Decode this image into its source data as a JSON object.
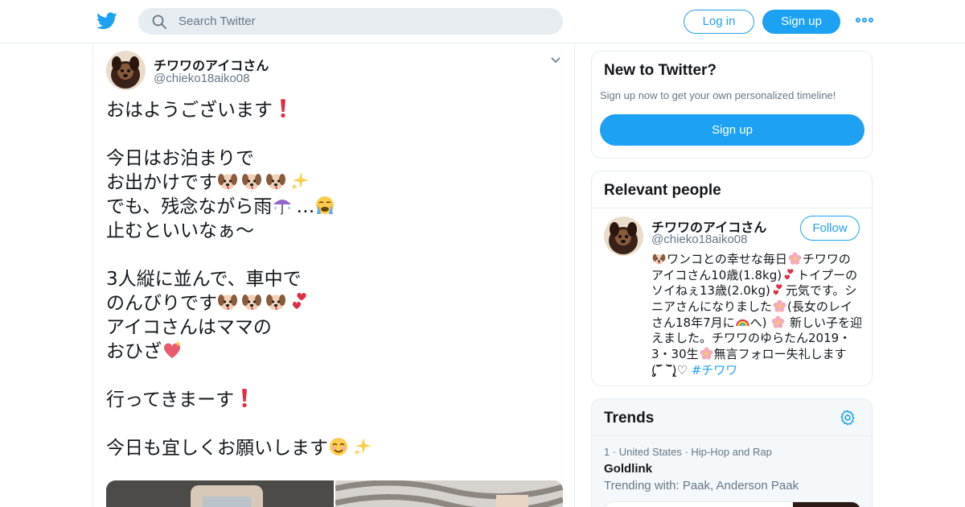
{
  "header": {
    "search_placeholder": "Search Twitter",
    "login_label": "Log in",
    "signup_label": "Sign up",
    "accent_color": "#1da1f2"
  },
  "tweet": {
    "display_name": "チワワのアイコさん",
    "handle": "@chieko18aiko08",
    "lines": [
      {
        "text": "おはようございます",
        "emojis": [
          "exclamation-icon"
        ]
      },
      {
        "text": "",
        "emojis": []
      },
      {
        "text": "今日はお泊まりで",
        "emojis": []
      },
      {
        "text": "お出かけです",
        "emojis": [
          "dog-face-icon",
          "dog-face-icon",
          "dog-face-icon",
          "sparkles-icon"
        ]
      },
      {
        "text": "でも、残念ながら雨",
        "emojis": [
          "umbrella-icon"
        ],
        "suffix": "…",
        "after": [
          "crying-face-icon"
        ]
      },
      {
        "text": "止むといいなぁ〜",
        "emojis": []
      },
      {
        "text": "",
        "emojis": []
      },
      {
        "text": "3人縦に並んで、車中で",
        "emojis": []
      },
      {
        "text": "のんびりです",
        "emojis": [
          "dog-face-icon",
          "dog-face-icon",
          "dog-face-icon",
          "two-hearts-icon"
        ]
      },
      {
        "text": "アイコさんはママの",
        "emojis": []
      },
      {
        "text": "おひざ",
        "emojis": [
          "sparkling-heart-icon"
        ]
      },
      {
        "text": "",
        "emojis": []
      },
      {
        "text": "行ってきまーす",
        "emojis": [
          "exclamation-icon"
        ]
      },
      {
        "text": "",
        "emojis": []
      },
      {
        "text": "今日も宜しくお願いします",
        "emojis": [
          "smiling-face-icon",
          "sparkles-icon"
        ]
      }
    ]
  },
  "new_to_twitter": {
    "title": "New to Twitter?",
    "subtitle": "Sign up now to get your own personalized timeline!",
    "button_label": "Sign up"
  },
  "relevant_people": {
    "title": "Relevant people",
    "display_name": "チワワのアイコさん",
    "handle": "@chieko18aiko08",
    "follow_label": "Follow",
    "bio_lines": [
      {
        "pre": [
          "dog-face-icon"
        ],
        "text": "ワンコとの幸せな毎日",
        "post": [
          "cherry-blossom-icon"
        ],
        "tail": "チワワの"
      },
      {
        "pre": [],
        "text": "アイコさん10歳(1.8kg)",
        "post": [
          "two-hearts-icon"
        ],
        "tail": "トイプーの"
      },
      {
        "pre": [],
        "text": "ソイねぇ13歳(2.0kg)",
        "post": [
          "two-hearts-icon"
        ],
        "tail": "元気です。シ"
      },
      {
        "pre": [],
        "text": "ニアさんになりました",
        "post": [
          "cherry-blossom-icon"
        ],
        "tail": "(長女のレイ"
      },
      {
        "pre": [],
        "text": "さん18年7月に",
        "post": [
          "rainbow-icon"
        ],
        "tail": "へ) "
      },
      {
        "pre": [],
        "text": "えました。チワワのゆらたん2019・",
        "post": [],
        "tail": ""
      },
      {
        "pre": [],
        "text": "3・30生",
        "post": [
          "cherry-blossom-icon"
        ],
        "tail": "無言フォロー失礼します"
      },
      {
        "pre": [],
        "text": "(̨̡‾᷄ ‾᷅)̧̢♡ ",
        "post": [],
        "tail": "",
        "hashtag": "#チワワ"
      }
    ],
    "bio_line5_extra": "新しい子を迎"
  },
  "trends": {
    "title": "Trends",
    "items": [
      {
        "rank": "1",
        "location": "United States",
        "category": "Hip-Hop and Rap",
        "name": "Goldlink",
        "with_label": "Trending with: Paak, Anderson Paak"
      }
    ]
  }
}
